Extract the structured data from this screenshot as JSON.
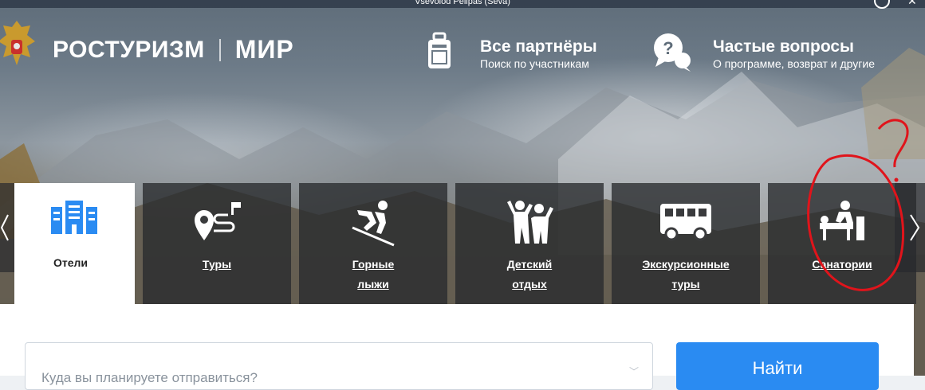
{
  "window": {
    "title": "Vsevolod Pelipas (Seva)"
  },
  "header": {
    "brand": "РОСТУРИЗМ",
    "brand_partner": "МИР",
    "partners": {
      "title": "Все партнёры",
      "subtitle": "Поиск по участникам"
    },
    "faq": {
      "title": "Частые вопросы",
      "subtitle": "О программе, возврат и другие"
    }
  },
  "tabs": [
    {
      "label": "Отели",
      "icon": "hotel-building-icon",
      "active": true
    },
    {
      "label": "Туры",
      "icon": "route-pin-icon",
      "active": false
    },
    {
      "label": "Горные лыжи",
      "line1": "Горные",
      "line2": "лыжи",
      "icon": "skier-icon",
      "active": false
    },
    {
      "label": "Детский отдых",
      "line1": "Детский",
      "line2": "отдых",
      "icon": "children-icon",
      "active": false
    },
    {
      "label": "Экскурсионные туры",
      "line1": "Экскурсионные",
      "line2": "туры",
      "icon": "bus-icon",
      "active": false
    },
    {
      "label": "Санатории",
      "icon": "massage-icon",
      "active": false
    }
  ],
  "search": {
    "placeholder": "Куда вы планируете отправиться?",
    "button": "Найти"
  },
  "colors": {
    "accent": "#2a8bf2",
    "hotel_icon": "#2a8bf2",
    "annotation": "#e0141b"
  }
}
